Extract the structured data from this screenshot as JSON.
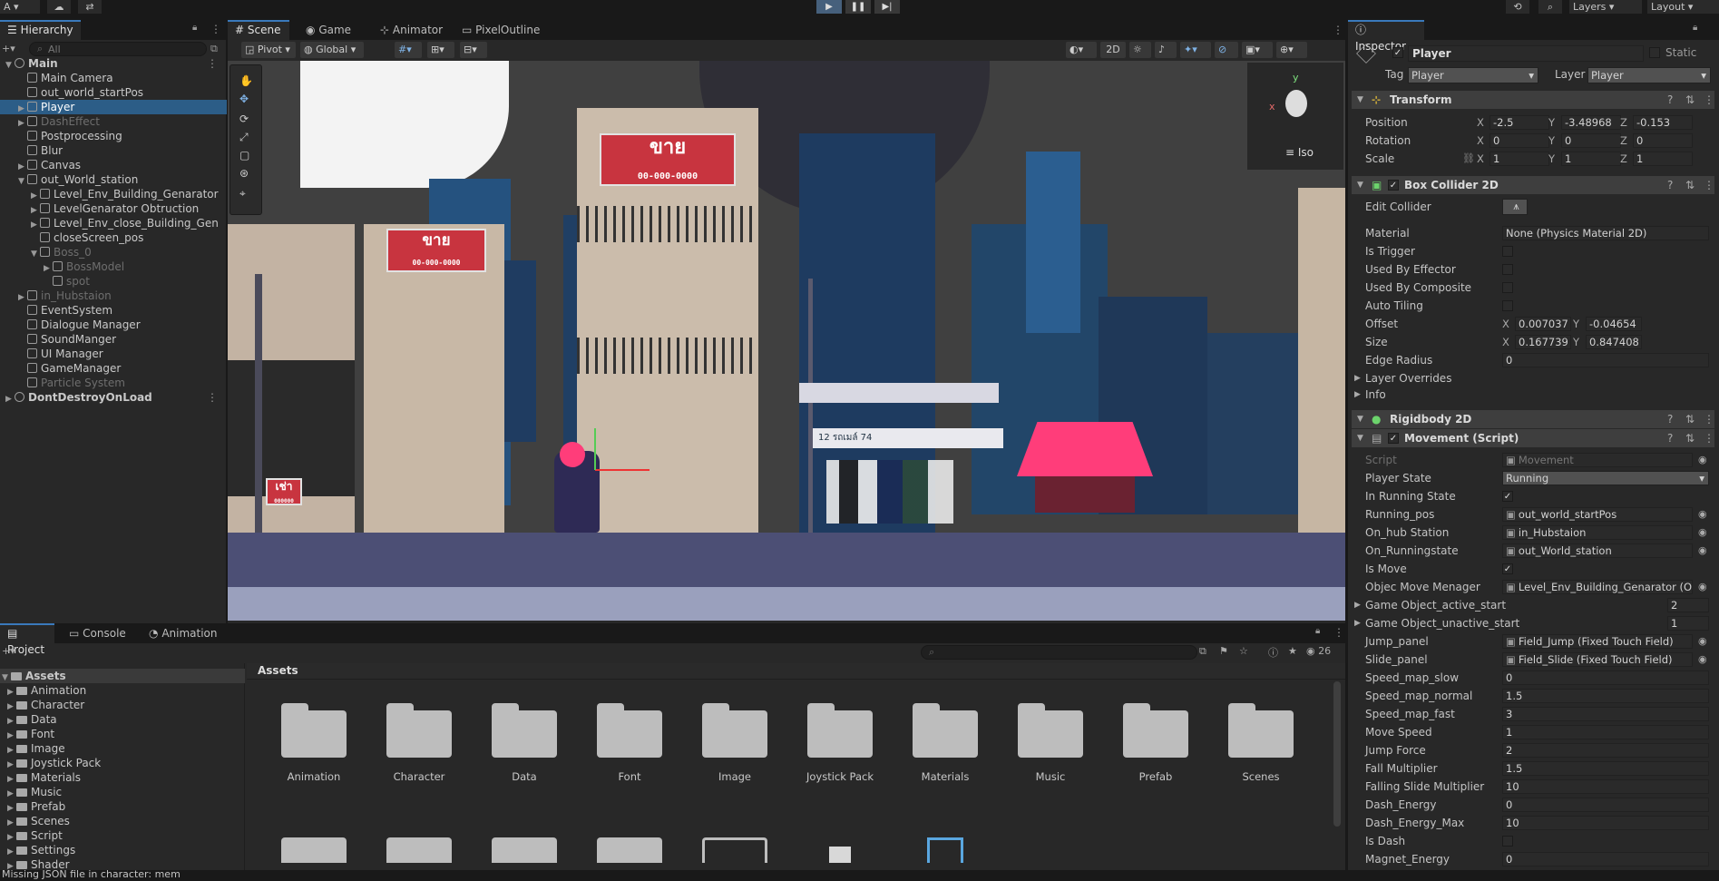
{
  "toolbar": {
    "account": "A",
    "layers": "Layers",
    "layout": "Layout"
  },
  "hierarchy": {
    "tab": "Hierarchy",
    "search": "All",
    "rows": [
      {
        "label": "Main",
        "depth": 0,
        "kind": "scene",
        "arrow": "▼"
      },
      {
        "label": "Main Camera",
        "depth": 1,
        "arrow": ""
      },
      {
        "label": "out_world_startPos",
        "depth": 1,
        "arrow": ""
      },
      {
        "label": "Player",
        "depth": 1,
        "arrow": "▶",
        "selected": true
      },
      {
        "label": "DashEffect",
        "depth": 1,
        "arrow": "▶",
        "dim": true
      },
      {
        "label": "Postprocessing",
        "depth": 1,
        "arrow": ""
      },
      {
        "label": "Blur",
        "depth": 1,
        "arrow": ""
      },
      {
        "label": "Canvas",
        "depth": 1,
        "arrow": "▶"
      },
      {
        "label": "out_World_station",
        "depth": 1,
        "arrow": "▼"
      },
      {
        "label": "Level_Env_Building_Genarator",
        "depth": 2,
        "arrow": "▶"
      },
      {
        "label": "LevelGenarator Obtruction",
        "depth": 2,
        "arrow": "▶"
      },
      {
        "label": "Level_Env_close_Building_Gen",
        "depth": 2,
        "arrow": "▶"
      },
      {
        "label": "closeScreen_pos",
        "depth": 2,
        "arrow": ""
      },
      {
        "label": "Boss_0",
        "depth": 2,
        "arrow": "▼",
        "dim": true
      },
      {
        "label": "BossModel",
        "depth": 3,
        "arrow": "▶",
        "dim": true
      },
      {
        "label": "spot",
        "depth": 3,
        "arrow": "",
        "dim": true
      },
      {
        "label": "in_Hubstaion",
        "depth": 1,
        "arrow": "▶",
        "dim": true
      },
      {
        "label": "EventSystem",
        "depth": 1,
        "arrow": ""
      },
      {
        "label": "Dialogue Manager",
        "depth": 1,
        "arrow": ""
      },
      {
        "label": "SoundManger",
        "depth": 1,
        "arrow": ""
      },
      {
        "label": "UI Manager",
        "depth": 1,
        "arrow": ""
      },
      {
        "label": "GameManager",
        "depth": 1,
        "arrow": ""
      },
      {
        "label": "Particle System",
        "depth": 1,
        "arrow": "",
        "dim": true
      },
      {
        "label": "DontDestroyOnLoad",
        "depth": 0,
        "kind": "scene",
        "arrow": "▶"
      }
    ]
  },
  "scene_tabs": [
    "Scene",
    "Game",
    "Animator",
    "PixelOutline"
  ],
  "scene_toolbar": {
    "pivot": "Pivot",
    "global": "Global",
    "mode_2d": "2D",
    "gizmo_label": "Iso",
    "gizmo_y": "y",
    "gizmo_x": "x"
  },
  "scene_signs": {
    "big_title": "ขาย",
    "big_phone": "00-000-0000",
    "mid_title": "ขาย",
    "mid_phone": "00-000-0000",
    "small_title": "เช่า",
    "small_sub": "000000",
    "bus_text": "12 รถเมล์ 74"
  },
  "inspector": {
    "tab": "Inspector",
    "object_name": "Player",
    "static_label": "Static",
    "tag_label": "Tag",
    "tag_value": "Player",
    "layer_label": "Layer",
    "layer_value": "Player",
    "transform": {
      "title": "Transform",
      "position_label": "Position",
      "position": {
        "x": "-2.5",
        "y": "-3.48968",
        "z": "-0.153"
      },
      "rotation_label": "Rotation",
      "rotation": {
        "x": "0",
        "y": "0",
        "z": "0"
      },
      "scale_label": "Scale",
      "scale": {
        "x": "1",
        "y": "1",
        "z": "1"
      }
    },
    "box_collider": {
      "title": "Box Collider 2D",
      "edit_collider": "Edit Collider",
      "material_label": "Material",
      "material_value": "None (Physics Material 2D)",
      "is_trigger": "Is Trigger",
      "used_by_effector": "Used By Effector",
      "used_by_composite": "Used By Composite",
      "auto_tiling": "Auto Tiling",
      "offset_label": "Offset",
      "offset": {
        "x": "0.007037",
        "y": "-0.04654"
      },
      "size_label": "Size",
      "size": {
        "x": "0.167739",
        "y": "0.847408"
      },
      "edge_radius_label": "Edge Radius",
      "edge_radius": "0",
      "layer_overrides": "Layer Overrides",
      "info": "Info"
    },
    "rigidbody": {
      "title": "Rigidbody 2D"
    },
    "movement": {
      "title": "Movement (Script)",
      "fields": [
        {
          "label": "Script",
          "value": "Movement",
          "type": "ref",
          "dim": true
        },
        {
          "label": "Player State",
          "value": "Running",
          "type": "dropdown"
        },
        {
          "label": "In Running State",
          "value": "✓",
          "type": "check"
        },
        {
          "label": "Running_pos",
          "value": "out_world_startPos",
          "type": "ref"
        },
        {
          "label": "On_hub Station",
          "value": "in_Hubstaion",
          "type": "ref"
        },
        {
          "label": "On_Runningstate",
          "value": "out_World_station",
          "type": "ref"
        },
        {
          "label": "Is Move",
          "value": "✓",
          "type": "check"
        },
        {
          "label": "Objec Move Menager",
          "value": "Level_Env_Building_Genarator (Obj",
          "type": "ref"
        },
        {
          "label": "Game Object_active_start",
          "value": "2",
          "type": "count",
          "fold": true
        },
        {
          "label": "Game Object_unactive_start",
          "value": "1",
          "type": "count",
          "fold": true
        },
        {
          "label": "Jump_panel",
          "value": "Field_Jump (Fixed Touch Field)",
          "type": "ref"
        },
        {
          "label": "Slide_panel",
          "value": "Field_Slide (Fixed Touch Field)",
          "type": "ref"
        },
        {
          "label": "Speed_map_slow",
          "value": "0",
          "type": "num"
        },
        {
          "label": "Speed_map_normal",
          "value": "1.5",
          "type": "num"
        },
        {
          "label": "Speed_map_fast",
          "value": "3",
          "type": "num"
        },
        {
          "label": "Move Speed",
          "value": "1",
          "type": "num"
        },
        {
          "label": "Jump Force",
          "value": "2",
          "type": "num"
        },
        {
          "label": "Fall Multiplier",
          "value": "1.5",
          "type": "num"
        },
        {
          "label": "Falling Slide Multiplier",
          "value": "10",
          "type": "num"
        },
        {
          "label": "Dash_Energy",
          "value": "0",
          "type": "num"
        },
        {
          "label": "Dash_Energy_Max",
          "value": "10",
          "type": "num"
        },
        {
          "label": "Is Dash",
          "value": "",
          "type": "check"
        },
        {
          "label": "Magnet_Energy",
          "value": "0",
          "type": "num"
        }
      ]
    }
  },
  "project": {
    "tabs": [
      "Project",
      "Console",
      "Animation"
    ],
    "tree": [
      "Assets",
      "Animation",
      "Character",
      "Data",
      "Font",
      "Image",
      "Joystick Pack",
      "Materials",
      "Music",
      "Prefab",
      "Scenes",
      "Script",
      "Settings",
      "Shader"
    ],
    "breadcrumb": "Assets",
    "asset_count": "26",
    "folders": [
      "Animation",
      "Character",
      "Data",
      "Font",
      "Image",
      "Joystick Pack",
      "Materials",
      "Music",
      "Prefab",
      "Scenes"
    ]
  },
  "status": {
    "message": "Missing JSON file in character: mem"
  },
  "colors": {
    "accent": "#3a79bb",
    "selection": "#2c5d87",
    "sign_red": "#c8343f",
    "tent_pink": "#ff3d7a"
  }
}
